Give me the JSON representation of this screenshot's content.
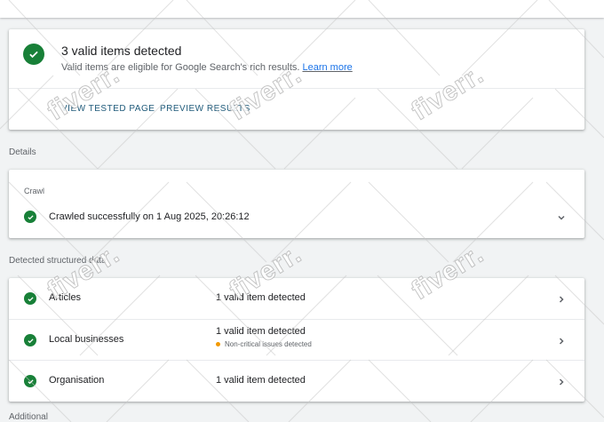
{
  "summary": {
    "title": "3 valid items detected",
    "description": "Valid items are eligible for Google Search's rich results.",
    "link": "Learn more",
    "actions": [
      "VIEW TESTED PAGE",
      "PREVIEW RESULTS"
    ]
  },
  "details": {
    "label": "Details",
    "crawl": {
      "header": "Crawl",
      "status": "Crawled successfully on 1 Aug 2025, 20:26:12"
    }
  },
  "structured": {
    "label": "Detected structured data",
    "rows": [
      {
        "name": "Articles",
        "status": "1 valid item detected",
        "note": ""
      },
      {
        "name": "Local businesses",
        "status": "1 valid item detected",
        "note": "Non-critical issues detected"
      },
      {
        "name": "Organisation",
        "status": "1 valid item detected",
        "note": ""
      }
    ]
  },
  "additional": {
    "label": "Additional"
  },
  "watermark": {
    "text": "fiverr."
  },
  "colors": {
    "success": "#188038",
    "warning": "#f29900",
    "link": "#1a73e8",
    "action": "#1f5a7a",
    "background": "#f1f3f4"
  },
  "icons": {
    "status": "check-circle-icon",
    "expand": "chevron-down-icon",
    "navigate": "chevron-right-icon",
    "warning": "warning-dot-icon"
  }
}
